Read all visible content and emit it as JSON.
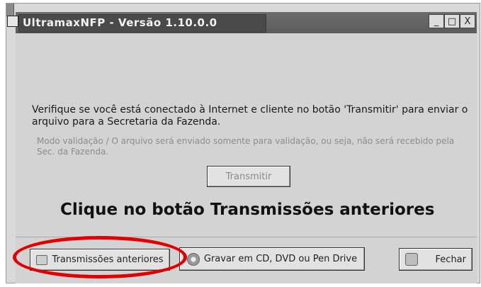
{
  "window": {
    "title": "UltramaxNFP - Versão 1.10.0.0",
    "controls": {
      "minimize": "_",
      "maximize": "□",
      "close": "X"
    }
  },
  "main": {
    "info_text": "Verifique se você está conectado à Internet e cliente no botão 'Transmitir' para enviar o arquivo para a Secretaria da Fazenda.",
    "note_text": "Modo validação / O arquivo será enviado somente para validação, ou seja, não será recebido pela Sec. da Fazenda.",
    "transmit_label": "Transmitir",
    "headline": "Clique no botão Transmissões anteriores"
  },
  "footer": {
    "previous_label": "Transmissões anteriores",
    "burn_label": "Gravar em CD, DVD ou Pen Drive",
    "close_label": "Fechar"
  },
  "icons": {
    "previous": "previous-transmissions-icon",
    "burn": "disc-icon",
    "close": "exit-icon"
  },
  "colors": {
    "highlight": "#e30000"
  }
}
